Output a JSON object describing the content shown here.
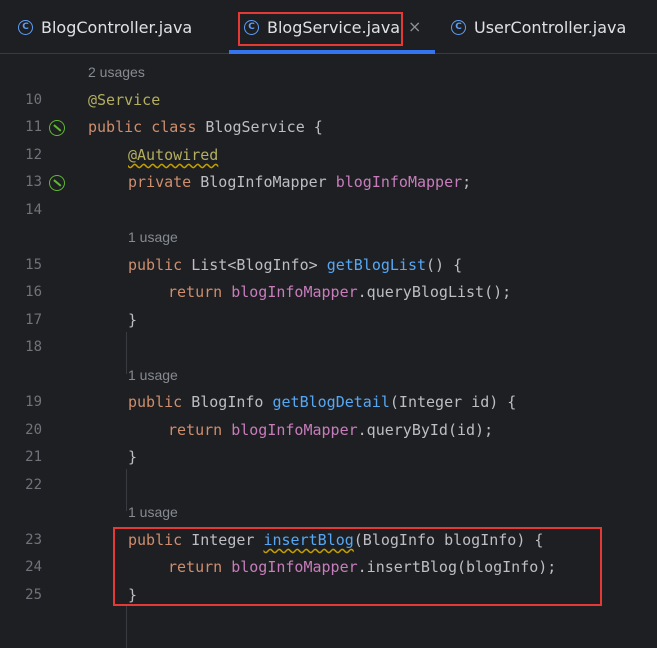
{
  "tabs": [
    {
      "label": "BlogController.java",
      "active": false
    },
    {
      "label": "BlogService.java",
      "active": true
    },
    {
      "label": "UserController.java",
      "active": false
    }
  ],
  "close_glyph": "×",
  "class_icon_glyph": "C",
  "hints": {
    "class_usages": "2 usages",
    "m1": "1 usage",
    "m2": "1 usage",
    "m3": "1 usage"
  },
  "lines": {
    "l10": "10",
    "l11": "11",
    "l12": "12",
    "l13": "13",
    "l14": "14",
    "l15": "15",
    "l16": "16",
    "l17": "17",
    "l18": "18",
    "l19": "19",
    "l20": "20",
    "l21": "21",
    "l22": "22",
    "l23": "23",
    "l24": "24",
    "l25": "25"
  },
  "code": {
    "c10_ann": "@Service",
    "c11_kw": "public class ",
    "c11_rest": "BlogService {",
    "c12_ann": "@Autowired",
    "c13_kw": "private ",
    "c13_type": "BlogInfoMapper ",
    "c13_fld": "blogInfoMapper",
    "c13_end": ";",
    "c15_kw": "public ",
    "c15_type": "List<BlogInfo> ",
    "c15_fn": "getBlogList",
    "c15_end": "() {",
    "c16_kw": "return ",
    "c16_fld": "blogInfoMapper",
    "c16_end": ".queryBlogList();",
    "c17": "}",
    "c19_kw": "public ",
    "c19_type": "BlogInfo ",
    "c19_fn": "getBlogDetail",
    "c19_end": "(Integer id) {",
    "c20_kw": "return ",
    "c20_fld": "blogInfoMapper",
    "c20_end": ".queryById(id);",
    "c21": "}",
    "c23_kw": "public ",
    "c23_type": "Integer ",
    "c23_fn": "insertBlog",
    "c23_end": "(BlogInfo blogInfo) {",
    "c24_kw": "return ",
    "c24_fld": "blogInfoMapper",
    "c24_end": ".insertBlog(blogInfo);",
    "c25": "}"
  },
  "colors": {
    "background": "#1e1f22",
    "keyword": "#cf8e6d",
    "annotation": "#b3ae60",
    "field": "#c77dbb",
    "method": "#56a8f5",
    "highlight_box": "#e53935",
    "active_tab_underline": "#3574f0"
  }
}
